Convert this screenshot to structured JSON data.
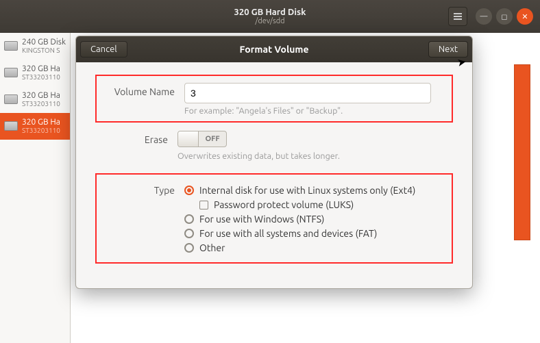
{
  "titlebar": {
    "title": "320 GB Hard Disk",
    "subtitle": "/dev/sdd"
  },
  "sidebar": {
    "items": [
      {
        "name": "240 GB Disk",
        "sub": "KINGSTON S"
      },
      {
        "name": "320 GB Ha",
        "sub": "ST33203110"
      },
      {
        "name": "320 GB Ha",
        "sub": "ST33203110"
      },
      {
        "name": "320 GB Ha",
        "sub": "ST33203110"
      }
    ]
  },
  "dialog": {
    "cancel_label": "Cancel",
    "title": "Format Volume",
    "next_label": "Next",
    "volume_name_label": "Volume Name",
    "volume_name_value": "3",
    "volume_name_hint": "For example: \"Angela's Files\" or \"Backup\".",
    "erase_label": "Erase",
    "erase_toggle": "OFF",
    "erase_hint": "Overwrites existing data, but takes longer.",
    "type_label": "Type",
    "type_options": {
      "ext4": "Internal disk for use with Linux systems only (Ext4)",
      "luks": "Password protect volume (LUKS)",
      "ntfs": "For use with Windows (NTFS)",
      "fat": "For use with all systems and devices (FAT)",
      "other": "Other"
    }
  }
}
